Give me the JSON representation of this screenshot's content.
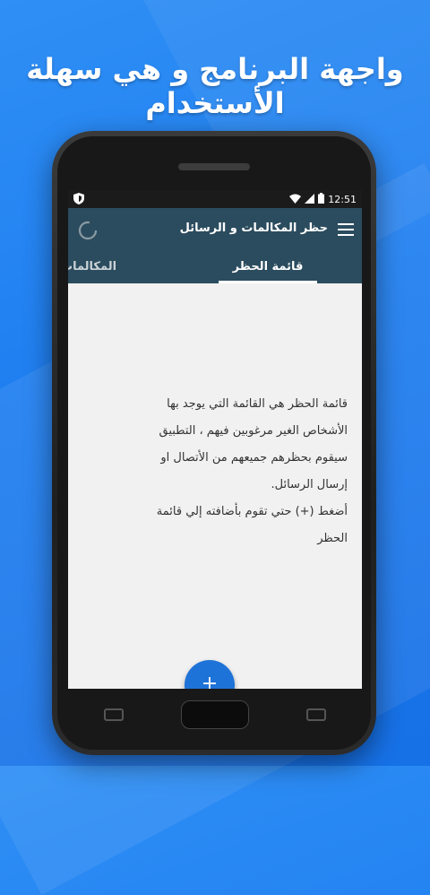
{
  "headline": "واجهة البرنامج و هي سهلة الأستخدام",
  "status_bar": {
    "time": "12:51",
    "left_icon": "shield-icon",
    "icons": [
      "wifi-icon",
      "signal-icon",
      "battery-icon"
    ]
  },
  "app_bar": {
    "title": "حظر المكالمات و الرسائل",
    "menu_icon": "hamburger-menu-icon",
    "refresh_icon": "refresh-icon"
  },
  "tabs": [
    {
      "label": "قائمة الحظر",
      "active": true
    },
    {
      "label": "المكالمات",
      "active": false
    }
  ],
  "description": {
    "line1": "قائمة الحظر هي القائمة التي يوجد بها",
    "line2": "الأشخاص الغير مرغوبين فيهم ، التطبيق",
    "line3": "سيقوم بحظرهم جميعهم من الأتصال او",
    "line4": "إرسال الرسائل.",
    "line5": "أضغط (+) حتي تقوم بأضافته إلي قائمة",
    "line6": "الحظر"
  },
  "fab": {
    "label": "+"
  },
  "colors": {
    "background": "#2486f3",
    "app_bar": "#2b4c5e",
    "fab": "#1e73d8"
  }
}
